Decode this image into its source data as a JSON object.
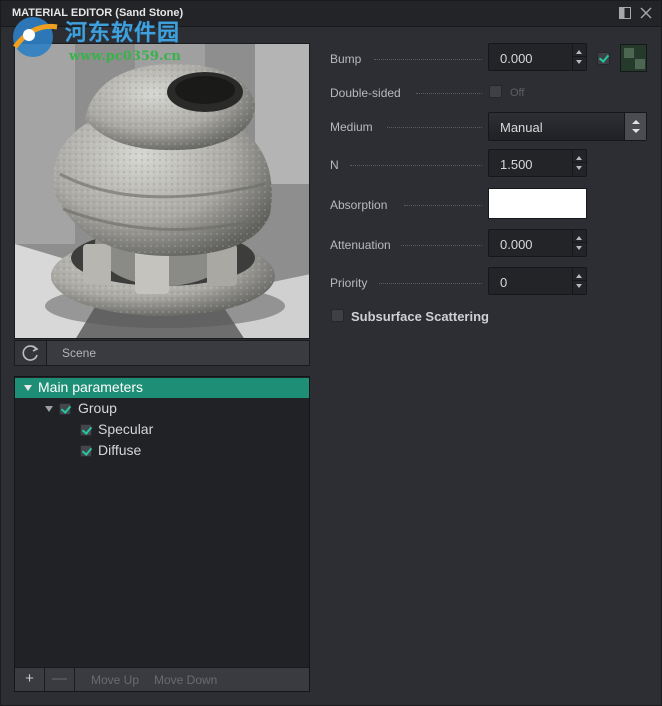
{
  "window": {
    "title": "MATERIAL EDITOR (Sand Stone)",
    "buttons": {
      "dock": "▯",
      "close": "✕"
    }
  },
  "watermark": {
    "chinese": "河东软件园",
    "url": "www.pc0359.cn"
  },
  "preview": {
    "refresh_icon": "refresh-icon",
    "scene_label": "Scene"
  },
  "tree": {
    "items": [
      {
        "label": "Main parameters",
        "level": 0,
        "expanded": true,
        "selected": true,
        "checkbox": false
      },
      {
        "label": "Group",
        "level": 1,
        "expanded": true,
        "selected": false,
        "checkbox": true,
        "checked": true
      },
      {
        "label": "Specular",
        "level": 2,
        "selected": false,
        "checkbox": true,
        "checked": true
      },
      {
        "label": "Diffuse",
        "level": 2,
        "selected": false,
        "checkbox": true,
        "checked": true
      }
    ],
    "footer": {
      "add": "+",
      "remove": "—",
      "move_up": "Move Up",
      "move_down": "Move Down"
    }
  },
  "properties": {
    "bump": {
      "label": "Bump",
      "value": "0.000",
      "texture_enabled": true
    },
    "double_sided": {
      "label": "Double-sided",
      "state": "Off",
      "checked": false
    },
    "medium": {
      "label": "Medium",
      "value": "Manual"
    },
    "n": {
      "label": "N",
      "value": "1.500"
    },
    "absorption": {
      "label": "Absorption",
      "color": "#ffffff"
    },
    "attenuation": {
      "label": "Attenuation",
      "value": "0.000"
    },
    "priority": {
      "label": "Priority",
      "value": "0"
    },
    "subsurface": {
      "label": "Subsurface Scattering",
      "checked": false
    }
  },
  "colors": {
    "accent": "#1e8f76",
    "check": "#23c7a0",
    "background": "#2d2e33",
    "panel": "#212226"
  }
}
